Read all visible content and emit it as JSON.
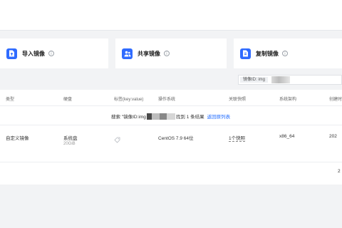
{
  "cards": [
    {
      "label": "导入镜像",
      "icon": "upload-file-icon"
    },
    {
      "label": "共享镜像",
      "icon": "share-users-icon"
    },
    {
      "label": "复制镜像",
      "icon": "copy-file-icon"
    }
  ],
  "search": {
    "tag": "镜像ID: img"
  },
  "table": {
    "columns": [
      "类型",
      "硬盘",
      "标签(key:value)",
      "操作系统",
      "关联快照",
      "系统架构",
      "创建时"
    ],
    "notice": {
      "prefix": "搜索 \"镜像ID:img",
      "suffix": "找到 1 条结果",
      "link": "返回原列表"
    },
    "row": {
      "type": "自定义镜像",
      "disk": "系统盘",
      "disk_size": "20GiB",
      "os": "CentOS 7.9 64位",
      "snapshot": "1个快照",
      "arch": "x86_64",
      "created": "202"
    },
    "footer": "2"
  },
  "colors": {
    "accent": "#2f6bff",
    "link": "#1f6bff"
  }
}
